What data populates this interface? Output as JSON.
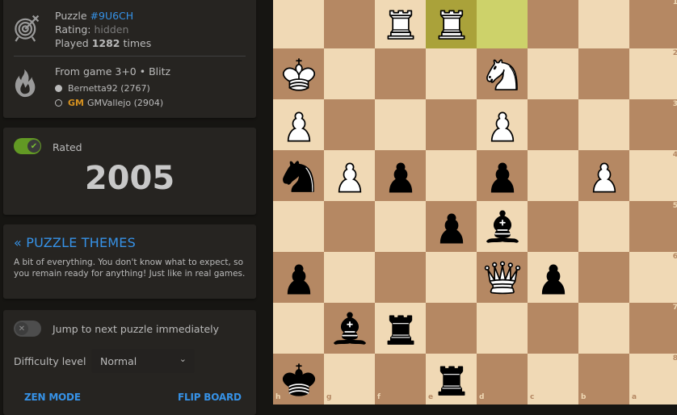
{
  "puzzle_info": {
    "puzzle_label": "Puzzle",
    "puzzle_id": "#9U6CH",
    "rating_label": "Rating:",
    "rating_value": "hidden",
    "played_prefix": "Played",
    "played_count": "1282",
    "played_suffix": "times",
    "icon": "target-icon"
  },
  "game_info": {
    "icon": "fire-icon",
    "from_game": "From game 3+0 • Blitz",
    "players": [
      {
        "color": "white",
        "title": "",
        "name": "Bernetta92 (2767)"
      },
      {
        "color": "black",
        "title": "GM",
        "name": "GMVallejo (2904)"
      }
    ]
  },
  "rating_panel": {
    "rated_toggle": true,
    "rated_label": "Rated",
    "rating": "2005"
  },
  "themes_panel": {
    "title": "« PUZZLE THEMES",
    "description": "A bit of everything. You don't know what to expect, so you remain ready for anything! Just like in real games."
  },
  "options_panel": {
    "jump_toggle": false,
    "jump_label": "Jump to next puzzle immediately",
    "difficulty_label": "Difficulty level",
    "difficulty_value": "Normal",
    "zen_mode_label": "ZEN MODE",
    "flip_board_label": "FLIP BOARD"
  },
  "board": {
    "orientation": "black",
    "files_display": [
      "h",
      "g",
      "f",
      "e",
      "d",
      "c",
      "b",
      "a"
    ],
    "ranks_display": [
      "1",
      "2",
      "3",
      "4",
      "5",
      "6",
      "7",
      "8"
    ],
    "last_move": [
      "e1",
      "d1"
    ],
    "colors": {
      "light": "#f0d9b5",
      "dark": "#b58863",
      "last_dark": "#aaa23a",
      "last_light": "#cdd26a"
    },
    "pieces": [
      {
        "square": "f1",
        "color": "white",
        "type": "rook"
      },
      {
        "square": "e1",
        "color": "white",
        "type": "rook"
      },
      {
        "square": "h2",
        "color": "white",
        "type": "king"
      },
      {
        "square": "d2",
        "color": "white",
        "type": "knight"
      },
      {
        "square": "h3",
        "color": "white",
        "type": "pawn"
      },
      {
        "square": "d3",
        "color": "white",
        "type": "pawn"
      },
      {
        "square": "h4",
        "color": "black",
        "type": "knight"
      },
      {
        "square": "g4",
        "color": "white",
        "type": "pawn"
      },
      {
        "square": "f4",
        "color": "black",
        "type": "pawn"
      },
      {
        "square": "d4",
        "color": "black",
        "type": "pawn"
      },
      {
        "square": "b4",
        "color": "white",
        "type": "pawn"
      },
      {
        "square": "e5",
        "color": "black",
        "type": "pawn"
      },
      {
        "square": "d5",
        "color": "black",
        "type": "bishop"
      },
      {
        "square": "h6",
        "color": "black",
        "type": "pawn"
      },
      {
        "square": "d6",
        "color": "white",
        "type": "queen"
      },
      {
        "square": "c6",
        "color": "black",
        "type": "pawn"
      },
      {
        "square": "g7",
        "color": "black",
        "type": "bishop"
      },
      {
        "square": "f7",
        "color": "black",
        "type": "rook"
      },
      {
        "square": "h8",
        "color": "black",
        "type": "king"
      },
      {
        "square": "e8",
        "color": "black",
        "type": "rook"
      }
    ]
  }
}
